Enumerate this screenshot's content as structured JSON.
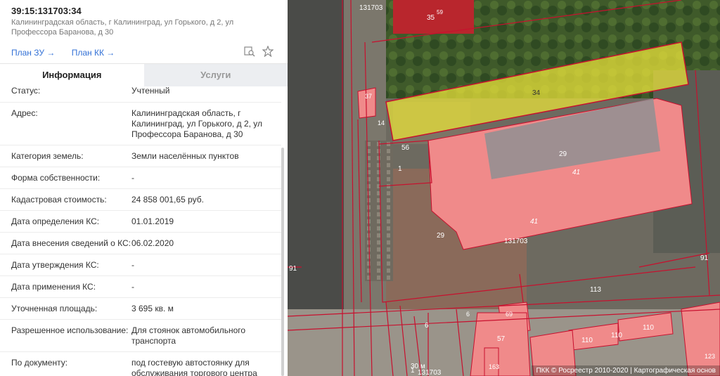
{
  "header": {
    "cadastral_number": "39:15:131703:34",
    "address": "Калининградская область, г Калининград, ул Горького, д 2, ул Профессора Баранова, д 30"
  },
  "links": {
    "plan_zu": "План ЗУ →",
    "plan_kk": "План КК →"
  },
  "tools": [
    "search-map-icon",
    "star-icon"
  ],
  "tabs": [
    {
      "label": "Информация",
      "active": true
    },
    {
      "label": "Услуги",
      "active": false
    }
  ],
  "fields": [
    {
      "key": "Статус:",
      "value": "Учтенный"
    },
    {
      "key": "Адрес:",
      "value": "Калининградская область, г Калининград, ул Горького, д 2, ул Профессора Баранова, д 30"
    },
    {
      "key": "Категория земель:",
      "value": "Земли населённых пунктов"
    },
    {
      "key": "Форма собственности:",
      "value": "-"
    },
    {
      "key": "Кадастровая стоимость:",
      "value": "24 858 001,65 руб."
    },
    {
      "key": "Дата определения КС:",
      "value": "01.01.2019"
    },
    {
      "key": "Дата внесения сведений о КС:",
      "value": "06.02.2020"
    },
    {
      "key": "Дата утверждения КС:",
      "value": "-"
    },
    {
      "key": "Дата применения КС:",
      "value": "-"
    },
    {
      "key": "Уточненная площадь:",
      "value": "3 695 кв. м"
    },
    {
      "key": "Разрешенное использование:",
      "value": "Для стоянок автомобильного транспорта"
    },
    {
      "key": "По документу:",
      "value": "под гостевую автостоянку для обслуживания торгового центра"
    }
  ],
  "map": {
    "labels": {
      "quarter_top": "131703",
      "building_35": "35",
      "building_59": "59",
      "parcel_34": "34",
      "parcel_29_main": "29",
      "parcel_41_a": "41",
      "parcel_41_b": "41",
      "parcel_29_b": "29",
      "quarter_mid": "131703",
      "parcel_56": "56",
      "parcel_1": "1",
      "parcel_37": "37",
      "parcel_14": "14",
      "parcel_91_left": "91",
      "parcel_91_right": "91",
      "parcel_113": "113",
      "parcel_6_a": "6",
      "parcel_6_b": "6",
      "parcel_69": "69",
      "parcel_57": "57",
      "parcel_110_a": "110",
      "parcel_110_b": "110",
      "parcel_110_c": "110",
      "parcel_163": "163",
      "parcel_123": "123",
      "quarter_bottom": "131703",
      "parcel_1_bottom": "1"
    },
    "scale": "30 м",
    "attribution": "ПКК © Росреестр 2010-2020 | Картографическая основ",
    "colors": {
      "selected_fill": "#e8e23a",
      "building_fill": "#f08a8a",
      "boundary": "#c8102e",
      "dark_building": "#c0272d"
    }
  }
}
